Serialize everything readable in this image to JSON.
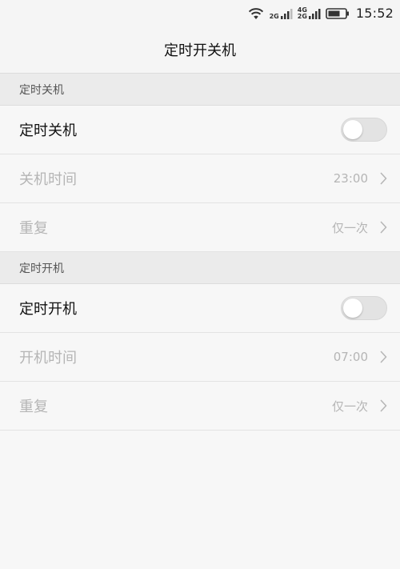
{
  "status_bar": {
    "time": "15:52",
    "sim1_network": "2G",
    "sim2_network_top": "4G",
    "sim2_network_bottom": "2G",
    "icons": [
      "wifi-icon",
      "signal-icon",
      "signal-icon",
      "battery-icon"
    ]
  },
  "header": {
    "title": "定时开关机"
  },
  "sections": [
    {
      "header": "定时关机",
      "toggle_label": "定时关机",
      "toggle_on": false,
      "time_label": "关机时间",
      "time_value": "23:00",
      "repeat_label": "重复",
      "repeat_value": "仅一次"
    },
    {
      "header": "定时开机",
      "toggle_label": "定时开机",
      "toggle_on": false,
      "time_label": "开机时间",
      "time_value": "07:00",
      "repeat_label": "重复",
      "repeat_value": "仅一次"
    }
  ],
  "colors": {
    "background": "#f7f7f7",
    "section_header_bg": "#ebebeb",
    "disabled_text": "#b5b5b5",
    "toggle_off": "#e3e3e3"
  }
}
